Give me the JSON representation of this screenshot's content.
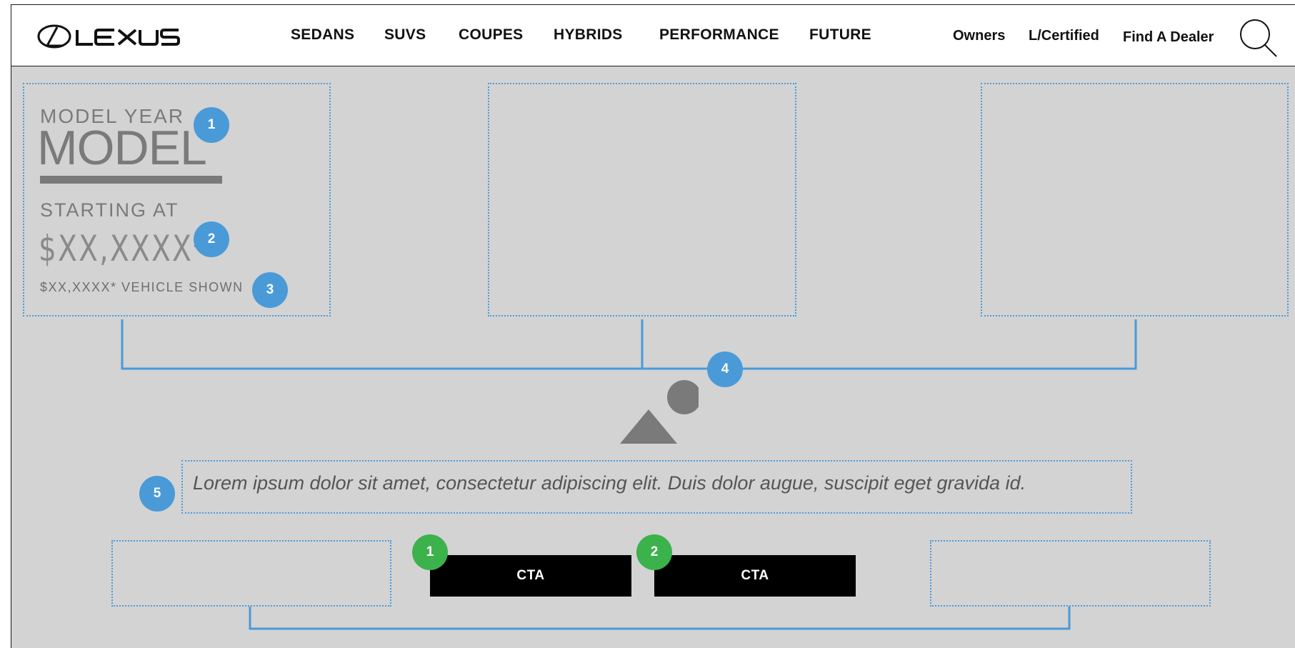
{
  "brand": {
    "name": "LEXUS"
  },
  "nav": {
    "items": [
      "SEDANS",
      "SUVS",
      "COUPES",
      "HYBRIDS",
      "PERFORMANCE",
      "FUTURE"
    ],
    "utility": [
      "Owners",
      "L/Certified",
      "Find A Dealer"
    ]
  },
  "icons": {
    "search": "search-icon",
    "image_placeholder": "image-placeholder-icon"
  },
  "model_card": {
    "model_year": "MODEL YEAR",
    "model": "MODEL",
    "starting_at": "STARTING AT",
    "price": "$XX,XXXX*",
    "vehicle_shown": "$XX,XXXX* VEHICLE SHOWN"
  },
  "description": "Lorem ipsum dolor sit amet, consectetur adipiscing elit. Duis dolor augue, suscipit eget gravida id.",
  "cta": {
    "primary_label": "CTA",
    "secondary_label": "CTA"
  },
  "annotations": {
    "blue": [
      "1",
      "2",
      "3",
      "4",
      "5"
    ],
    "green": [
      "1",
      "2"
    ]
  },
  "colors": {
    "canvas": "#d3d3d3",
    "annotation_blue": "#4a9ad8",
    "annotation_green": "#3bb24b",
    "cta_background": "#000000",
    "text_gray": "#7a7a7a"
  }
}
